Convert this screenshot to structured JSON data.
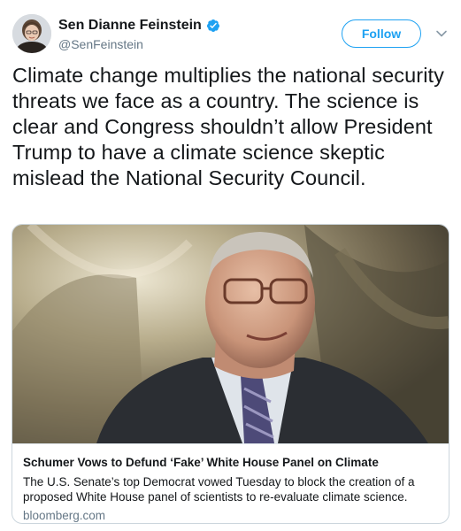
{
  "author": {
    "display_name": "Sen Dianne Feinstein",
    "handle": "@SenFeinstein",
    "verified_icon": "verified-badge-icon",
    "avatar_icon": "profile-photo"
  },
  "actions": {
    "follow_label": "Follow",
    "menu_icon": "chevron-down-icon"
  },
  "tweet": {
    "text": "Climate change multiplies the national security threats we face as a country. The science is clear and Congress shouldn’t allow President Trump to have a climate science skeptic mislead the National Security Council."
  },
  "link_card": {
    "title": "Schumer Vows to Defund ‘Fake’ White House Panel on Climate",
    "description": "The U.S. Senate’s top Democrat vowed Tuesday to block the creation of a proposed White House panel of scientists to re-evaluate climate science.",
    "domain": "bloomberg.com",
    "image": "photo of a man in glasses and suit speaking"
  },
  "colors": {
    "accent": "#1da1f2",
    "text": "#14171a",
    "secondary": "#657786",
    "border": "#ccd6dd"
  }
}
